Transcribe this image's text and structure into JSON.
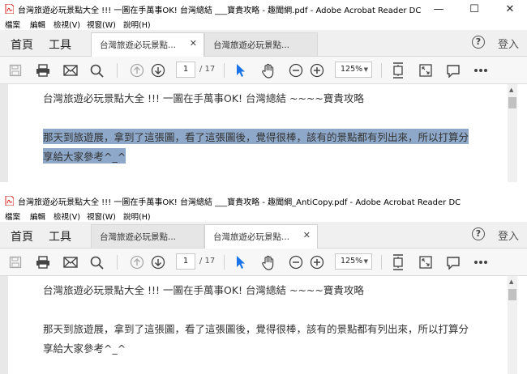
{
  "windows": [
    {
      "title": "台灣旅遊必玩景點大全 !!! 一圖在手萬事OK! 台灣總結 ___寶貴攻略 - 趣聞網.pdf - Adobe Acrobat Reader DC",
      "menu": [
        "檔案",
        "編輯",
        "檢視(V)",
        "視窗(W)",
        "說明(H)"
      ],
      "nav": {
        "home": "首頁",
        "tools": "工具",
        "login": "登入",
        "help": "?"
      },
      "tabs": [
        {
          "label": "台灣旅遊必玩景點...",
          "active": true
        },
        {
          "label": "台灣旅遊必玩景點...",
          "active": false
        }
      ],
      "toolbar": {
        "page_current": "1",
        "page_total": "/ 17",
        "zoom": "125%"
      },
      "document": {
        "line1": "台灣旅遊必玩景點大全 !!!   一圖在手萬事OK!    台灣總結 ~~~~寶貴攻略",
        "line2": "那天到旅遊展，拿到了這張圖，看了這張圖後，覺得很棒，該有的景點都有列出來，所以打算分",
        "line3": "享給大家參考^_^",
        "selection_active": true
      }
    },
    {
      "title": "台灣旅遊必玩景點大全 !!! 一圖在手萬事OK! 台灣總結 ___寶貴攻略 - 趣聞網_AntiCopy.pdf - Adobe Acrobat Reader DC",
      "menu": [
        "檔案",
        "編輯",
        "檢視(V)",
        "視窗(W)",
        "說明(H)"
      ],
      "nav": {
        "home": "首頁",
        "tools": "工具",
        "login": "登入",
        "help": "?"
      },
      "tabs": [
        {
          "label": "台灣旅遊必玩景點...",
          "active": false
        },
        {
          "label": "台灣旅遊必玩景點...",
          "active": true
        }
      ],
      "toolbar": {
        "page_current": "1",
        "page_total": "/ 17",
        "zoom": "125%"
      },
      "document": {
        "line1": "台灣旅遊必玩景點大全 !!!   一圖在手萬事OK!    台灣總結 ~~~~寶貴攻略",
        "line2": "那天到旅遊展，拿到了這張圖，看了這張圖後，覺得很棒，該有的景點都有列出來，所以打算分",
        "line3": "享給大家參考^_^",
        "selection_active": false
      }
    }
  ],
  "window_controls": {
    "minimize": "—",
    "maximize": "☐",
    "close": "✕"
  },
  "colors": {
    "selection": "#8ea8c9",
    "pdf_red": "#d8231f",
    "select_tool_blue": "#1a73e8"
  }
}
